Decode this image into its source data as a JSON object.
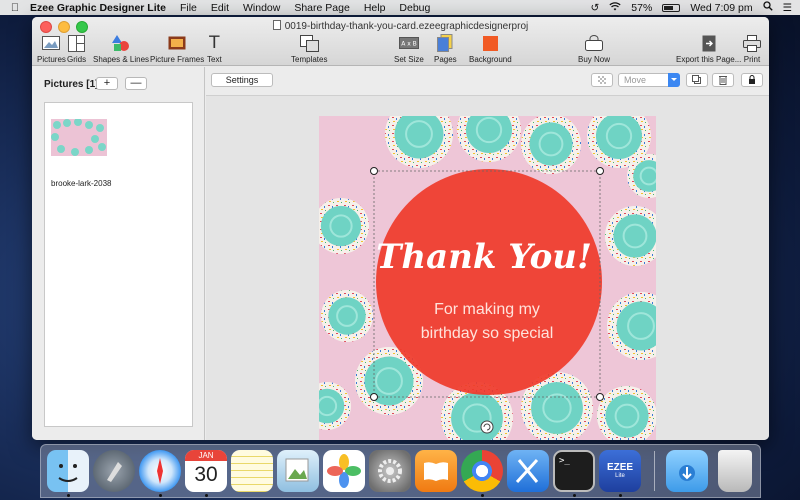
{
  "menubar": {
    "app_name": "Ezee Graphic Designer Lite",
    "items": [
      "File",
      "Edit",
      "Window",
      "Share Page",
      "Help",
      "Debug"
    ],
    "battery": "57%",
    "clock": "Wed 7:09 pm"
  },
  "window": {
    "title": "0019-birthday-thank-you-card.ezeegraphicdesignerproj"
  },
  "toolbar": {
    "pictures": "Pictures",
    "grids": "Grids",
    "shapes": "Shapes & Lines",
    "frames": "Picture Frames",
    "text": "Text",
    "templates": "Templates",
    "set_size": "Set Size",
    "pages": "Pages",
    "background": "Background",
    "buy_now": "Buy Now",
    "export": "Export this Page...",
    "print": "Print",
    "background_color": "#f15a24"
  },
  "sidebar": {
    "title": "Pictures [1]",
    "add_label": "+",
    "remove_label": "—",
    "items": [
      {
        "label": "brooke-lark-2038"
      }
    ]
  },
  "canvas_toolbar": {
    "settings_label": "Settings",
    "mode_value": "Move"
  },
  "card": {
    "heading": "Thank You!",
    "line1": "For making my",
    "line2": "birthday so special",
    "circle_color": "#ef3a2a",
    "background_color": "#eec6d7",
    "frosting_color": "#6fd3c4"
  },
  "dock": {
    "apps": [
      {
        "name": "finder-icon"
      },
      {
        "name": "launchpad-icon"
      },
      {
        "name": "safari-icon"
      },
      {
        "name": "calendar-icon"
      },
      {
        "name": "notes-icon"
      },
      {
        "name": "preview-icon"
      },
      {
        "name": "photos-icon"
      },
      {
        "name": "system-preferences-icon"
      },
      {
        "name": "ibooks-icon"
      },
      {
        "name": "chrome-icon"
      },
      {
        "name": "xcode-icon"
      },
      {
        "name": "terminal-icon"
      },
      {
        "name": "ezee-app-icon"
      },
      {
        "name": "downloads-folder-icon"
      },
      {
        "name": "trash-icon"
      }
    ],
    "calendar_month": "JAN",
    "calendar_day": "30",
    "ezee_label": "EZEE",
    "ezee_sub": "Lite"
  }
}
